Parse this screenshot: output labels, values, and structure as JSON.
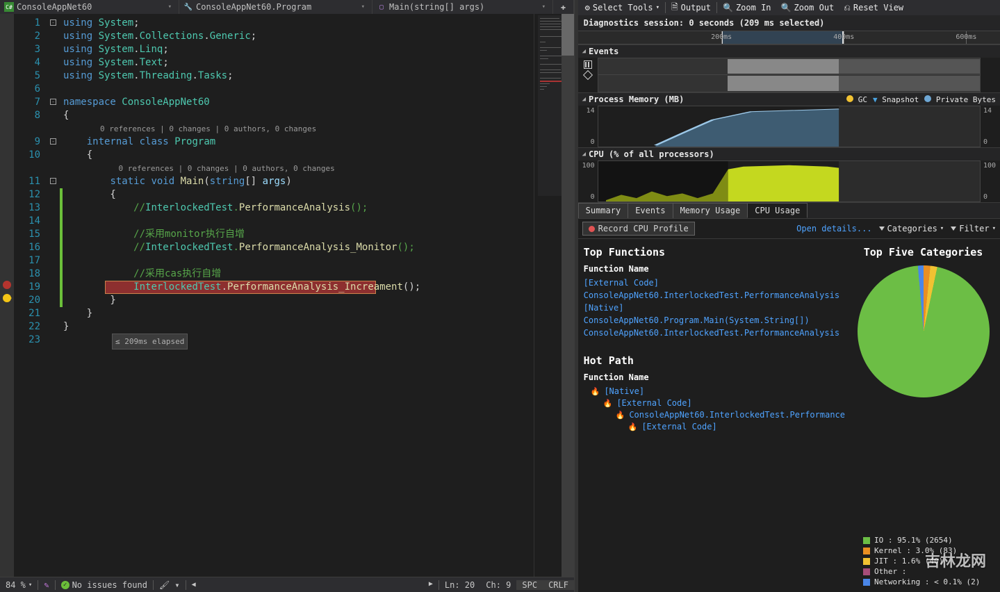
{
  "breadcrumbs": {
    "file_icon": "C#",
    "file": "ConsoleAppNet60",
    "class_icon": "🔑",
    "class": "ConsoleAppNet60.Program",
    "method_icon": "🔒",
    "method": "Main(string[] args)"
  },
  "code": {
    "codelens1": "0 references | 0 changes | 0 authors, 0 changes",
    "codelens2": "0 references | 0 changes | 0 authors, 0 changes",
    "lines": [
      {
        "n": 1,
        "t": "using System;"
      },
      {
        "n": 2,
        "t": "using System.Collections.Generic;"
      },
      {
        "n": 3,
        "t": "using System.Linq;"
      },
      {
        "n": 4,
        "t": "using System.Text;"
      },
      {
        "n": 5,
        "t": "using System.Threading.Tasks;"
      },
      {
        "n": 6,
        "t": ""
      },
      {
        "n": 7,
        "t": "namespace ConsoleAppNet60"
      },
      {
        "n": 8,
        "t": "{"
      },
      {
        "n": 9,
        "t": "    internal class Program"
      },
      {
        "n": 10,
        "t": "    {"
      },
      {
        "n": 11,
        "t": "        static void Main(string[] args)"
      },
      {
        "n": 12,
        "t": "        {"
      },
      {
        "n": 13,
        "t": "            //InterlockedTest.PerformanceAnalysis();"
      },
      {
        "n": 14,
        "t": ""
      },
      {
        "n": 15,
        "t": "            //采用monitor执行自增"
      },
      {
        "n": 16,
        "t": "            //InterlockedTest.PerformanceAnalysis_Monitor();"
      },
      {
        "n": 17,
        "t": ""
      },
      {
        "n": 18,
        "t": "            //采用cas执行自增"
      },
      {
        "n": 19,
        "t": "            InterlockedTest.PerformanceAnalysis_Increament();"
      },
      {
        "n": 20,
        "t": "        }"
      },
      {
        "n": 21,
        "t": "    }"
      },
      {
        "n": 22,
        "t": "}"
      },
      {
        "n": 23,
        "t": ""
      }
    ],
    "highlight_line": 19,
    "breakpoint_line": 19,
    "current_line": 20,
    "perf_tip": "≤ 209ms elapsed"
  },
  "status": {
    "zoom": "84 %",
    "issues": "No issues found",
    "pos_line": "Ln: 20",
    "pos_col": "Ch: 9",
    "spc": "SPC",
    "crlf": "CRLF"
  },
  "diag": {
    "toolbar": {
      "select_tools": "Select Tools",
      "output": "Output",
      "zoom_in": "Zoom In",
      "zoom_out": "Zoom Out",
      "reset_view": "Reset View"
    },
    "session": "Diagnostics session: 0 seconds (209 ms selected)",
    "time_ticks": [
      "200ms",
      "400ms",
      "600ms"
    ],
    "events_label": "Events",
    "memory": {
      "label": "Process Memory (MB)",
      "ymax": "14",
      "ymin": "0",
      "legend_gc": "GC",
      "legend_snapshot": "Snapshot",
      "legend_pb": "Private Bytes"
    },
    "cpu_graph": {
      "label": "CPU (% of all processors)",
      "ymax": "100",
      "ymin": "0"
    },
    "tabs": [
      "Summary",
      "Events",
      "Memory Usage",
      "CPU Usage"
    ],
    "active_tab": 3,
    "record_btn": "Record CPU Profile",
    "open_details": "Open details...",
    "categories": "Categories",
    "filter": "Filter",
    "top_functions": "Top Functions",
    "fn_col": "Function Name",
    "functions": [
      "[External Code]",
      "ConsoleAppNet60.InterlockedTest.PerformanceAnalysis",
      "[Native]",
      "ConsoleAppNet60.Program.Main(System.String[])",
      "ConsoleAppNet60.InterlockedTest.PerformanceAnalysis"
    ],
    "hot_path": "Hot Path",
    "hot": [
      {
        "indent": 0,
        "label": "[Native]"
      },
      {
        "indent": 1,
        "label": "[External Code]"
      },
      {
        "indent": 2,
        "label": "ConsoleAppNet60.InterlockedTest.Performance"
      },
      {
        "indent": 3,
        "label": "[External Code]"
      }
    ],
    "top_categories": "Top Five Categories",
    "chart_data": {
      "type": "pie",
      "title": "Top Five Categories",
      "series": [
        {
          "name": "IO",
          "value": 95.1,
          "count": 2654,
          "color": "#6cbe45"
        },
        {
          "name": "Kernel",
          "value": 3.0,
          "count": 83,
          "color": "#e98f22"
        },
        {
          "name": "JIT",
          "value": 1.6,
          "count": 40,
          "color": "#f1c232"
        },
        {
          "name": "Other",
          "value": 0.2,
          "count": null,
          "color": "#a64d79"
        },
        {
          "name": "Networking",
          "value": 0.1,
          "count": 2,
          "color": "#4a86e8"
        }
      ]
    },
    "legend": [
      {
        "color": "#6cbe45",
        "label": "IO : 95.1% (2654)"
      },
      {
        "color": "#e98f22",
        "label": "Kernel : 3.0% (83)"
      },
      {
        "color": "#f1c232",
        "label": "JIT : 1.6% (40)"
      },
      {
        "color": "#a64d79",
        "label": "Other :"
      },
      {
        "color": "#4a86e8",
        "label": "Networking : < 0.1% (2)"
      }
    ]
  },
  "watermark": "吉林龙网"
}
